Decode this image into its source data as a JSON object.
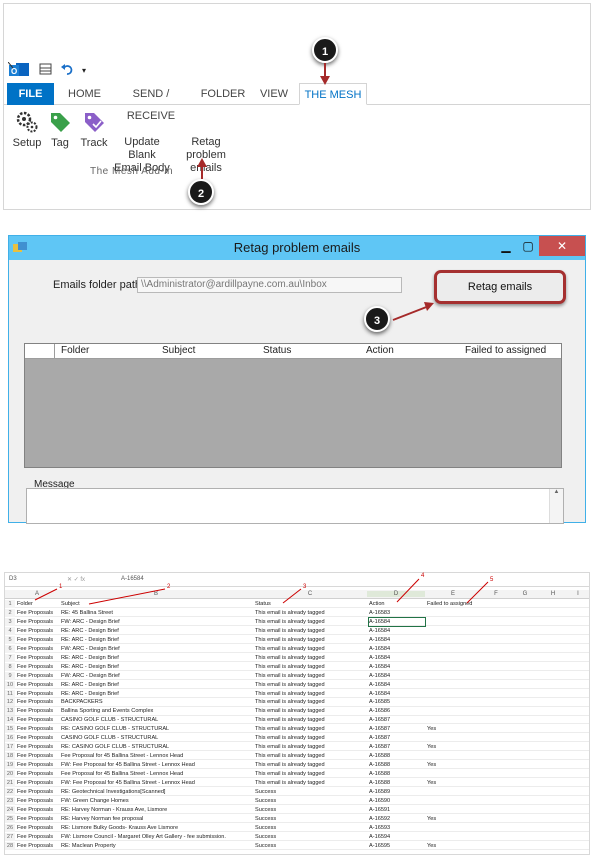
{
  "ribbon": {
    "tabs": [
      "FILE",
      "HOME",
      "SEND / RECEIVE",
      "FOLDER",
      "VIEW",
      "THE MESH"
    ],
    "buttons": [
      {
        "label_line1": "Setup",
        "label_line2": ""
      },
      {
        "label_line1": "Tag",
        "label_line2": ""
      },
      {
        "label_line1": "Track",
        "label_line2": ""
      },
      {
        "label_line1": "Update Blank",
        "label_line2": "Email Body"
      },
      {
        "label_line1": "Retag problem",
        "label_line2": "emails"
      }
    ],
    "group_label": "The Mesh Add-in"
  },
  "callouts": [
    "1",
    "2",
    "3"
  ],
  "dialog": {
    "title": "Retag problem emails",
    "path_label": "Emails folder path:",
    "path_value": "\\\\Administrator@ardillpayne.com.au\\Inbox",
    "retag_button": "Retag emails",
    "columns": [
      "Folder",
      "Subject",
      "Status",
      "Action",
      "Failed to assigned"
    ],
    "message_label": "Message"
  },
  "excel": {
    "cell_ref": "D3",
    "formula": "A-16584",
    "column_letters": [
      "A",
      "B",
      "C",
      "D",
      "E",
      "F",
      "G",
      "H",
      "I"
    ],
    "annotations": [
      "1",
      "2",
      "3",
      "4",
      "5"
    ],
    "rows": [
      {
        "n": "1",
        "a": "Folder",
        "b": "Subject",
        "c": "Status",
        "d": "Action",
        "e": "Failed to assigned"
      },
      {
        "n": "2",
        "a": "Fee Proposals",
        "b": "RE: 45 Ballina Street",
        "c": "This email is already tagged",
        "d": "A-16583",
        "e": ""
      },
      {
        "n": "3",
        "a": "Fee Proposals",
        "b": "FW: ARC - Design Brief",
        "c": "This email is already tagged",
        "d": "A-16584",
        "e": ""
      },
      {
        "n": "4",
        "a": "Fee Proposals",
        "b": "RE: ARC - Design Brief",
        "c": "This email is already tagged",
        "d": "A-16584",
        "e": ""
      },
      {
        "n": "5",
        "a": "Fee Proposals",
        "b": "RE: ARC - Design Brief",
        "c": "This email is already tagged",
        "d": "A-16584",
        "e": ""
      },
      {
        "n": "6",
        "a": "Fee Proposals",
        "b": "FW: ARC - Design Brief",
        "c": "This email is already tagged",
        "d": "A-16584",
        "e": ""
      },
      {
        "n": "7",
        "a": "Fee Proposals",
        "b": "RE: ARC - Design Brief",
        "c": "This email is already tagged",
        "d": "A-16584",
        "e": ""
      },
      {
        "n": "8",
        "a": "Fee Proposals",
        "b": "RE: ARC - Design Brief",
        "c": "This email is already tagged",
        "d": "A-16584",
        "e": ""
      },
      {
        "n": "9",
        "a": "Fee Proposals",
        "b": "FW: ARC - Design Brief",
        "c": "This email is already tagged",
        "d": "A-16584",
        "e": ""
      },
      {
        "n": "10",
        "a": "Fee Proposals",
        "b": "RE: ARC - Design Brief",
        "c": "This email is already tagged",
        "d": "A-16584",
        "e": ""
      },
      {
        "n": "11",
        "a": "Fee Proposals",
        "b": "RE: ARC - Design Brief",
        "c": "This email is already tagged",
        "d": "A-16584",
        "e": ""
      },
      {
        "n": "12",
        "a": "Fee Proposals",
        "b": "BACKPACKERS",
        "c": "This email is already tagged",
        "d": "A-16585",
        "e": ""
      },
      {
        "n": "13",
        "a": "Fee Proposals",
        "b": "Ballina Sporting and Events Complex",
        "c": "This email is already tagged",
        "d": "A-16586",
        "e": ""
      },
      {
        "n": "14",
        "a": "Fee Proposals",
        "b": "CASINO GOLF CLUB - STRUCTURAL",
        "c": "This email is already tagged",
        "d": "A-16587",
        "e": ""
      },
      {
        "n": "15",
        "a": "Fee Proposals",
        "b": "RE: CASINO GOLF CLUB - STRUCTURAL",
        "c": "This email is already tagged",
        "d": "A-16587",
        "e": "Yes"
      },
      {
        "n": "16",
        "a": "Fee Proposals",
        "b": "CASINO GOLF CLUB - STRUCTURAL",
        "c": "This email is already tagged",
        "d": "A-16587",
        "e": ""
      },
      {
        "n": "17",
        "a": "Fee Proposals",
        "b": "RE: CASINO GOLF CLUB - STRUCTURAL",
        "c": "This email is already tagged",
        "d": "A-16587",
        "e": "Yes"
      },
      {
        "n": "18",
        "a": "Fee Proposals",
        "b": "Fee Proposal for 45 Ballina Street - Lennox Head",
        "c": "This email is already tagged",
        "d": "A-16588",
        "e": ""
      },
      {
        "n": "19",
        "a": "Fee Proposals",
        "b": "FW: Fee Proposal for 45 Ballina Street - Lennox Head",
        "c": "This email is already tagged",
        "d": "A-16588",
        "e": "Yes"
      },
      {
        "n": "20",
        "a": "Fee Proposals",
        "b": "Fee Proposal for 45 Ballina Street - Lennox Head",
        "c": "This email is already tagged",
        "d": "A-16588",
        "e": ""
      },
      {
        "n": "21",
        "a": "Fee Proposals",
        "b": "FW: Fee Proposal for 45 Ballina Street - Lennox Head",
        "c": "This email is already tagged",
        "d": "A-16588",
        "e": "Yes"
      },
      {
        "n": "22",
        "a": "Fee Proposals",
        "b": "RE: Geotechnical Investigations[Scanned]",
        "c": "Success",
        "d": "A-16589",
        "e": ""
      },
      {
        "n": "23",
        "a": "Fee Proposals",
        "b": "FW: Green Change Homes",
        "c": "Success",
        "d": "A-16590",
        "e": ""
      },
      {
        "n": "24",
        "a": "Fee Proposals",
        "b": "RE: Harvey Norman - Krauss Ave, Lismore",
        "c": "Success",
        "d": "A-16591",
        "e": ""
      },
      {
        "n": "25",
        "a": "Fee Proposals",
        "b": "RE: Harvey Norman fee proposal",
        "c": "Success",
        "d": "A-16592",
        "e": "Yes"
      },
      {
        "n": "26",
        "a": "Fee Proposals",
        "b": "RE: Lismore Bulky Goods- Krauss Ave Lismore",
        "c": "Success",
        "d": "A-16593",
        "e": ""
      },
      {
        "n": "27",
        "a": "Fee Proposals",
        "b": "FW: Lismore Council - Margaret Olley Art Gallery - fee submission.",
        "c": "Success",
        "d": "A-16594",
        "e": ""
      },
      {
        "n": "28",
        "a": "Fee Proposals",
        "b": "RE: Maclean Property",
        "c": "Success",
        "d": "A-16595",
        "e": "Yes"
      }
    ]
  }
}
